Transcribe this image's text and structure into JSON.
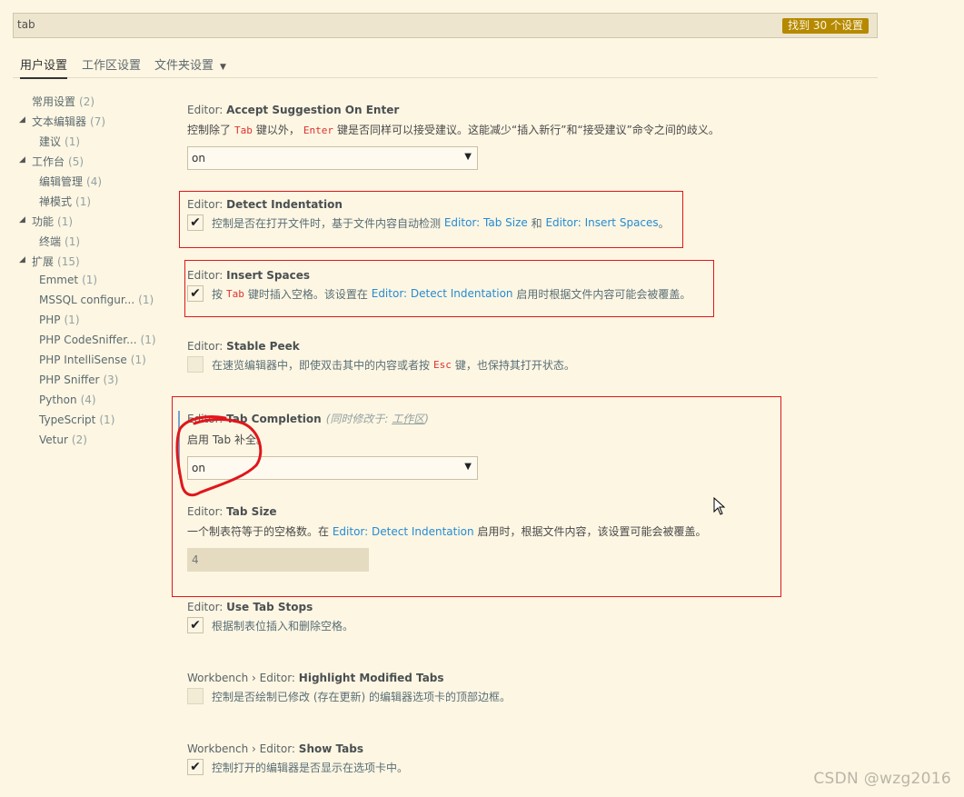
{
  "search": {
    "value": "tab",
    "result_count": "找到 30 个设置"
  },
  "tabs": [
    {
      "label": "用户设置",
      "active": true
    },
    {
      "label": "工作区设置",
      "active": false
    },
    {
      "label": "文件夹设置",
      "active": false,
      "dropdown": true
    }
  ],
  "toc": [
    {
      "label": "常用设置",
      "count": "(2)"
    },
    {
      "label": "文本编辑器",
      "count": "(7)",
      "expanded": true
    },
    {
      "label": "建议",
      "count": "(1)"
    },
    {
      "label": "工作台",
      "count": "(5)",
      "expanded": true
    },
    {
      "label": "编辑管理",
      "count": "(4)"
    },
    {
      "label": "禅模式",
      "count": "(1)"
    },
    {
      "label": "功能",
      "count": "(1)",
      "expanded": true
    },
    {
      "label": "终端",
      "count": "(1)"
    },
    {
      "label": "扩展",
      "count": "(15)",
      "expanded": true
    },
    {
      "label": "Emmet",
      "count": "(1)"
    },
    {
      "label": "MSSQL configur...",
      "count": "(1)"
    },
    {
      "label": "PHP",
      "count": "(1)"
    },
    {
      "label": "PHP CodeSniffer...",
      "count": "(1)"
    },
    {
      "label": "PHP IntelliSense",
      "count": "(1)"
    },
    {
      "label": "PHP Sniffer",
      "count": "(3)"
    },
    {
      "label": "Python",
      "count": "(4)"
    },
    {
      "label": "TypeScript",
      "count": "(1)"
    },
    {
      "label": "Vetur",
      "count": "(2)"
    }
  ],
  "settings": {
    "accept": {
      "category": "Editor: ",
      "name": "Accept Suggestion On Enter",
      "desc_a": "控制除了",
      "code_a": "Tab",
      "desc_b": "键以外，",
      "code_b": "Enter",
      "desc_c": "键是否同样可以接受建议。这能减少“插入新行”和“接受建议”命令之间的歧义。",
      "value": "on"
    },
    "detect": {
      "category": "Editor: ",
      "name": "Detect Indentation",
      "checked": true,
      "desc_a": "控制是否在打开文件时，基于文件内容自动检测",
      "link_a": "Editor: Tab Size",
      "desc_b": "和",
      "link_b": "Editor: Insert Spaces",
      "desc_c": "。"
    },
    "insert": {
      "category": "Editor: ",
      "name": "Insert Spaces",
      "checked": true,
      "desc_a": "按",
      "code_a": "Tab",
      "desc_b": "键时插入空格。该设置在",
      "link_a": "Editor: Detect Indentation",
      "desc_c": "启用时根据文件内容可能会被覆盖。"
    },
    "peek": {
      "category": "Editor: ",
      "name": "Stable Peek",
      "checked": false,
      "desc_a": "在速览编辑器中，即使双击其中的内容或者按",
      "code_a": "Esc",
      "desc_b": "键，也保持其打开状态。"
    },
    "completion": {
      "category": "Editor: ",
      "name": "Tab Completion",
      "modified_prefix": "(同时修改于: ",
      "modified_link": "工作区",
      "modified_suffix": ")",
      "desc": "启用 Tab 补全。",
      "value": "on"
    },
    "tabsize": {
      "category": "Editor: ",
      "name": "Tab Size",
      "desc_a": "一个制表符等于的空格数。在",
      "link_a": "Editor: Detect Indentation",
      "desc_b": "启用时，根据文件内容，该设置可能会被覆盖。",
      "value": "4"
    },
    "tabstops": {
      "category": "Editor: ",
      "name": "Use Tab Stops",
      "checked": true,
      "desc": "根据制表位插入和删除空格。"
    },
    "highlight": {
      "category": "Workbench › Editor: ",
      "name": "Highlight Modified Tabs",
      "checked": false,
      "desc": "控制是否绘制已修改 (存在更新) 的编辑器选项卡的顶部边框。"
    },
    "showtabs": {
      "category": "Workbench › Editor: ",
      "name": "Show Tabs",
      "checked": true,
      "desc": "控制打开的编辑器是否显示在选项卡中。"
    }
  },
  "watermark": "CSDN @wzg2016",
  "colors": {
    "background": "#fdf6e3",
    "badge": "#b58900",
    "link": "#268bd2",
    "annotation": "#e0161b"
  }
}
